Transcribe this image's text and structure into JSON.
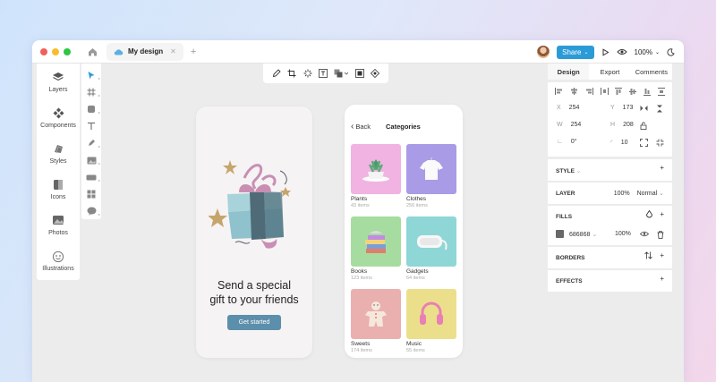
{
  "colors": {
    "accent": "#2b9bd8",
    "dot_red": "#f25f58",
    "dot_yellow": "#f9bd2e",
    "dot_green": "#29c840",
    "fill_swatch": "#686868",
    "cta": "#5c8fab"
  },
  "titlebar": {
    "tab_label": "My design",
    "share_label": "Share",
    "zoom_label": "100%"
  },
  "left_panel": {
    "items": [
      {
        "label": "Layers",
        "icon": "layers-icon"
      },
      {
        "label": "Components",
        "icon": "components-icon"
      },
      {
        "label": "Styles",
        "icon": "styles-icon"
      },
      {
        "label": "Icons",
        "icon": "icons-icon"
      },
      {
        "label": "Photos",
        "icon": "photos-icon"
      },
      {
        "label": "Illustrations",
        "icon": "illustrations-icon"
      }
    ]
  },
  "tool_strip": [
    "select-tool-icon",
    "frame-tool-icon",
    "shape-tool-icon",
    "text-tool-icon",
    "pen-tool-icon",
    "image-tool-icon",
    "button-tool-icon",
    "component-tool-icon",
    "chat-tool-icon"
  ],
  "top_tools": [
    "pencil-icon",
    "crop-icon",
    "magic-icon",
    "text-frame-icon",
    "layers-stack-icon",
    "grid-frame-icon",
    "target-icon"
  ],
  "phone1": {
    "headline_line1": "Send a special",
    "headline_line2": "gift to your friends",
    "button_label": "Get started"
  },
  "phone2": {
    "back_label": "Back",
    "title": "Categories",
    "categories": [
      {
        "name": "Plants",
        "count": "43 items",
        "color": "#f0b3e2"
      },
      {
        "name": "Clothes",
        "count": "256 items",
        "color": "#a99be6"
      },
      {
        "name": "Books",
        "count": "123 items",
        "color": "#a7dca0"
      },
      {
        "name": "Gadgets",
        "count": "64 items",
        "color": "#8fd6d6"
      },
      {
        "name": "Sweets",
        "count": "174 items",
        "color": "#eab0b0"
      },
      {
        "name": "Music",
        "count": "55 items",
        "color": "#ecdf8c"
      }
    ]
  },
  "right_panel": {
    "tabs": [
      "Design",
      "Export",
      "Comments"
    ],
    "props": {
      "x_key": "X",
      "x_val": "254",
      "y_key": "Y",
      "y_val": "173",
      "w_key": "W",
      "w_val": "254",
      "h_key": "H",
      "h_val": "208",
      "angle_val": "0°",
      "radius_val": "10"
    },
    "style_label": "STYLE",
    "layer_label": "LAYER",
    "layer_opacity": "100%",
    "layer_mode": "Normal",
    "fills_label": "FILLS",
    "fill_hex": "686868",
    "fill_opacity": "100%",
    "borders_label": "BORDERS",
    "effects_label": "EFFECTS"
  }
}
